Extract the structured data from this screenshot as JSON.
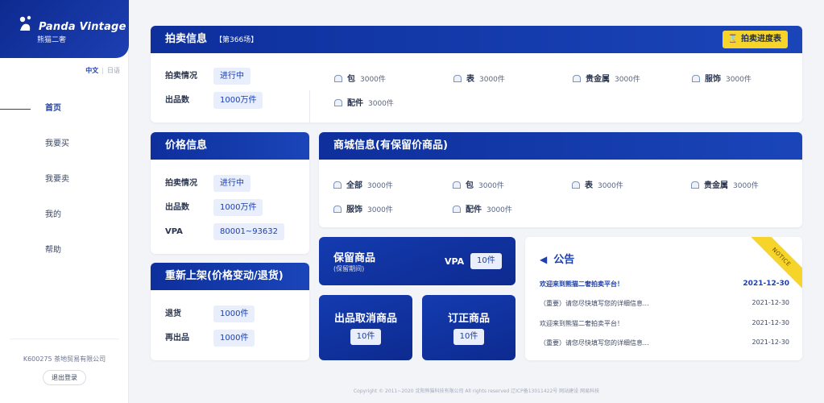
{
  "brand": {
    "name": "Panda Vintage",
    "subtitle": "熊猫二奢"
  },
  "lang": {
    "active": "中文",
    "other": "日语"
  },
  "nav": [
    "首页",
    "我要买",
    "我要卖",
    "我的",
    "帮助"
  ],
  "sidebar_footer": {
    "company": "K600275 茶地贸易有限公司",
    "logout": "退出登录"
  },
  "auction": {
    "title": "拍卖信息",
    "session": "【第366场】",
    "progress_button": "拍卖进度表",
    "status_label": "拍卖情况",
    "status_value": "进行中",
    "count_label": "出品数",
    "count_value": "1000万件",
    "categories": [
      {
        "name": "包",
        "count": "3000件"
      },
      {
        "name": "表",
        "count": "3000件"
      },
      {
        "name": "贵金属",
        "count": "3000件"
      },
      {
        "name": "服饰",
        "count": "3000件"
      },
      {
        "name": "配件",
        "count": "3000件"
      }
    ]
  },
  "price": {
    "title": "价格信息",
    "status_label": "拍卖情况",
    "status_value": "进行中",
    "count_label": "出品数",
    "count_value": "1000万件",
    "vpa_label": "VPA",
    "vpa_value": "80001~93632"
  },
  "mall": {
    "title": "商城信息(有保留价商品)",
    "categories": [
      {
        "name": "全部",
        "count": "3000件"
      },
      {
        "name": "包",
        "count": "3000件"
      },
      {
        "name": "表",
        "count": "3000件"
      },
      {
        "name": "贵金属",
        "count": "3000件"
      },
      {
        "name": "服饰",
        "count": "3000件"
      },
      {
        "name": "配件",
        "count": "3000件"
      }
    ]
  },
  "relist": {
    "title": "重新上架(价格变动/退货)",
    "return_label": "退货",
    "return_value": "1000件",
    "relist_label": "再出品",
    "relist_value": "1000件"
  },
  "reserved": {
    "title": "保留商品",
    "sub": "(保留期间)",
    "vpa_label": "VPA",
    "value": "10件"
  },
  "cancelled": {
    "title": "出品取消商品",
    "value": "10件"
  },
  "corrected": {
    "title": "订正商品",
    "value": "10件"
  },
  "notice": {
    "title": "公告",
    "ribbon": "NOTICE",
    "items": [
      {
        "text": "欢迎来到熊猫二奢拍卖平台！",
        "date": "2021-12-30"
      },
      {
        "text": "（重要）请您尽快填写您的详细信息...",
        "date": "2021-12-30"
      },
      {
        "text": "欢迎来到熊猫二奢拍卖平台！",
        "date": "2021-12-30"
      },
      {
        "text": "（重要）请您尽快填写您的详细信息...",
        "date": "2021-12-30"
      }
    ]
  },
  "footer": "Copyright © 2011~2020 沈阳熊猫科技有限公司 All rights reserved  辽ICP备13011422号    网站建设    网易科技",
  "colors": {
    "primary": "#1c3fb2",
    "dark_primary": "#0d2a8f",
    "accent": "#f6d42a",
    "bg": "#f2f4f8"
  }
}
